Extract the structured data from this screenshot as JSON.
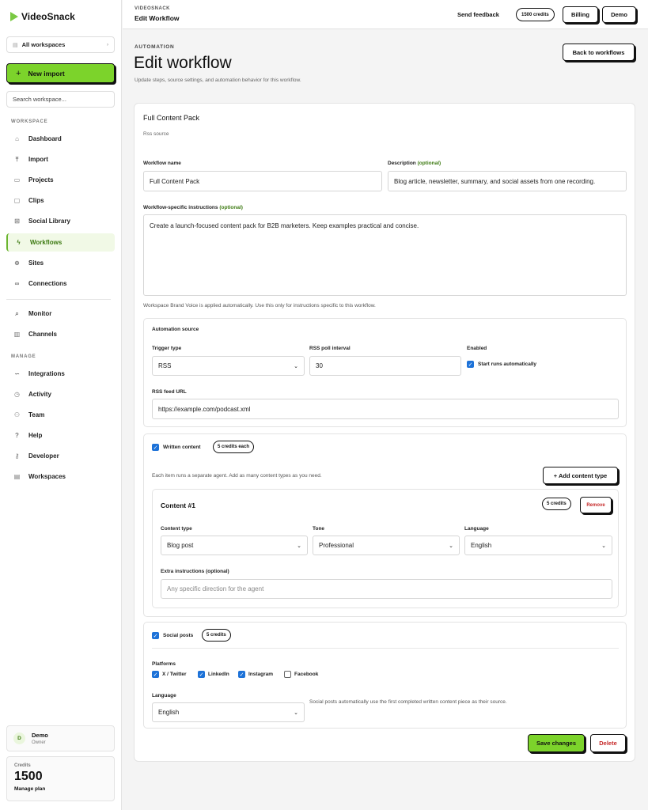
{
  "brand": {
    "name": "VideoSnack",
    "accent": "#7cd32b"
  },
  "sidebar": {
    "workspace_select": "All workspaces",
    "new_import": "New import",
    "search_placeholder": "Search workspace...",
    "section_workspace": "WORKSPACE",
    "section_manage": "MANAGE",
    "items": [
      {
        "label": "Dashboard",
        "icon": "home-icon"
      },
      {
        "label": "Import",
        "icon": "upload-icon"
      },
      {
        "label": "Projects",
        "icon": "folder-icon"
      },
      {
        "label": "Clips",
        "icon": "video-icon"
      },
      {
        "label": "Social Library",
        "icon": "grid-icon"
      },
      {
        "label": "Workflows",
        "icon": "bolt-icon",
        "active": true
      },
      {
        "label": "Sites",
        "icon": "globe-icon"
      },
      {
        "label": "Connections",
        "icon": "link-icon"
      },
      {
        "label": "Monitor",
        "icon": "search-icon"
      },
      {
        "label": "Channels",
        "icon": "bar-chart-icon"
      }
    ],
    "manage_items": [
      {
        "label": "Integrations",
        "icon": "plug-icon"
      },
      {
        "label": "Activity",
        "icon": "clock-icon"
      },
      {
        "label": "Team",
        "icon": "users-icon"
      },
      {
        "label": "Help",
        "icon": "help-icon"
      },
      {
        "label": "Developer",
        "icon": "key-icon"
      },
      {
        "label": "Workspaces",
        "icon": "workspaces-icon"
      }
    ],
    "user": {
      "initial": "D",
      "name": "Demo",
      "role": "Owner"
    },
    "credits": {
      "label": "Credits",
      "value": "1500",
      "manage": "Manage plan"
    }
  },
  "topbar": {
    "crumb": "VIDEOSNACK",
    "title": "Edit Workflow",
    "feedback": "Send feedback",
    "credits": "1500 credits",
    "billing": "Billing",
    "workspace": "Demo"
  },
  "page": {
    "eyebrow": "AUTOMATION",
    "title": "Edit workflow",
    "subtitle": "Update steps, source settings, and automation behavior for this workflow.",
    "back": "Back to workflows"
  },
  "form": {
    "pack_title": "Full Content Pack",
    "pack_source": "Rss source",
    "name_label": "Workflow name",
    "name_value": "Full Content Pack",
    "desc_label": "Description",
    "optional": "(optional)",
    "desc_value": "Blog article, newsletter, summary, and social assets from one recording.",
    "instr_label": "Workflow-specific instructions",
    "instr_value": "Create a launch-focused content pack for B2B marketers. Keep examples practical and concise.",
    "instr_note": "Workspace Brand Voice is applied automatically. Use this only for instructions specific to this workflow.",
    "automation": {
      "title": "Automation source",
      "trigger_label": "Trigger type",
      "trigger_value": "RSS",
      "poll_label": "RSS poll interval",
      "poll_value": "30",
      "enabled_label": "Enabled",
      "start_label": "Start runs automatically",
      "feed_label": "RSS feed URL",
      "feed_value": "https://example.com/podcast.xml"
    },
    "written": {
      "label": "Written content",
      "pill": "5 credits each",
      "note": "Each item runs a separate agent. Add as many content types as you need.",
      "add": "+ Add content type",
      "item": {
        "title": "Content #1",
        "credits": "5 credits",
        "remove": "Remove",
        "type_label": "Content type",
        "type_value": "Blog post",
        "tone_label": "Tone",
        "tone_value": "Professional",
        "lang_label": "Language",
        "lang_value": "English",
        "extra_label": "Extra instructions",
        "extra_placeholder": "Any specific direction for the agent"
      }
    },
    "social": {
      "label": "Social posts",
      "pill": "5 credits",
      "platforms_label": "Platforms",
      "platforms": [
        {
          "name": "X / Twitter",
          "checked": true
        },
        {
          "name": "LinkedIn",
          "checked": true
        },
        {
          "name": "Instagram",
          "checked": true
        },
        {
          "name": "Facebook",
          "checked": false
        }
      ],
      "lang_label": "Language",
      "lang_value": "English",
      "note": "Social posts automatically use the first completed written content piece as their source."
    },
    "save": "Save changes",
    "delete": "Delete",
    "delete_color": "#c62828"
  }
}
